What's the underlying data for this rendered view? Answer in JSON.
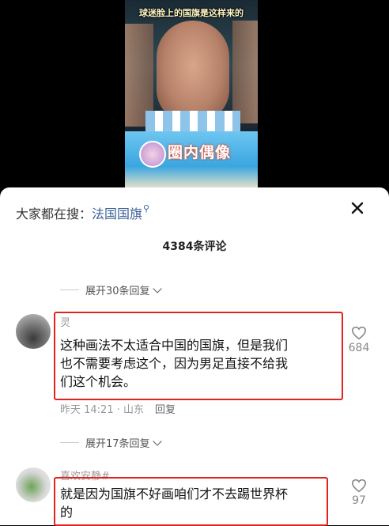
{
  "video": {
    "title": "球迷脸上的国旗是这样来的",
    "banner_text": "圈内偶像"
  },
  "search": {
    "prefix": "大家都在搜：",
    "keyword": "法国国旗",
    "search_icon": "search-icon"
  },
  "header": {
    "comment_count": "4384条评论"
  },
  "expand_top": "展开30条回复",
  "comments": [
    {
      "username": "灵",
      "text_lines": [
        "这种画法不太适合中国的国旗，但是我们",
        "也不需要考虑这个，因为男足直接不给我",
        "们这个机会。"
      ],
      "time_location": "昨天 14:21 · 山东",
      "reply_label": "回复",
      "likes": "684"
    },
    {
      "username": "喜欢安静#",
      "text_lines": [
        "就是因为国旗不好画咱们才不去踢世界杯",
        "的"
      ],
      "likes": "97"
    }
  ],
  "expand_mid": "展开17条回复",
  "colors": {
    "highlight_border": "#e0231f",
    "link": "#3a5e96"
  }
}
